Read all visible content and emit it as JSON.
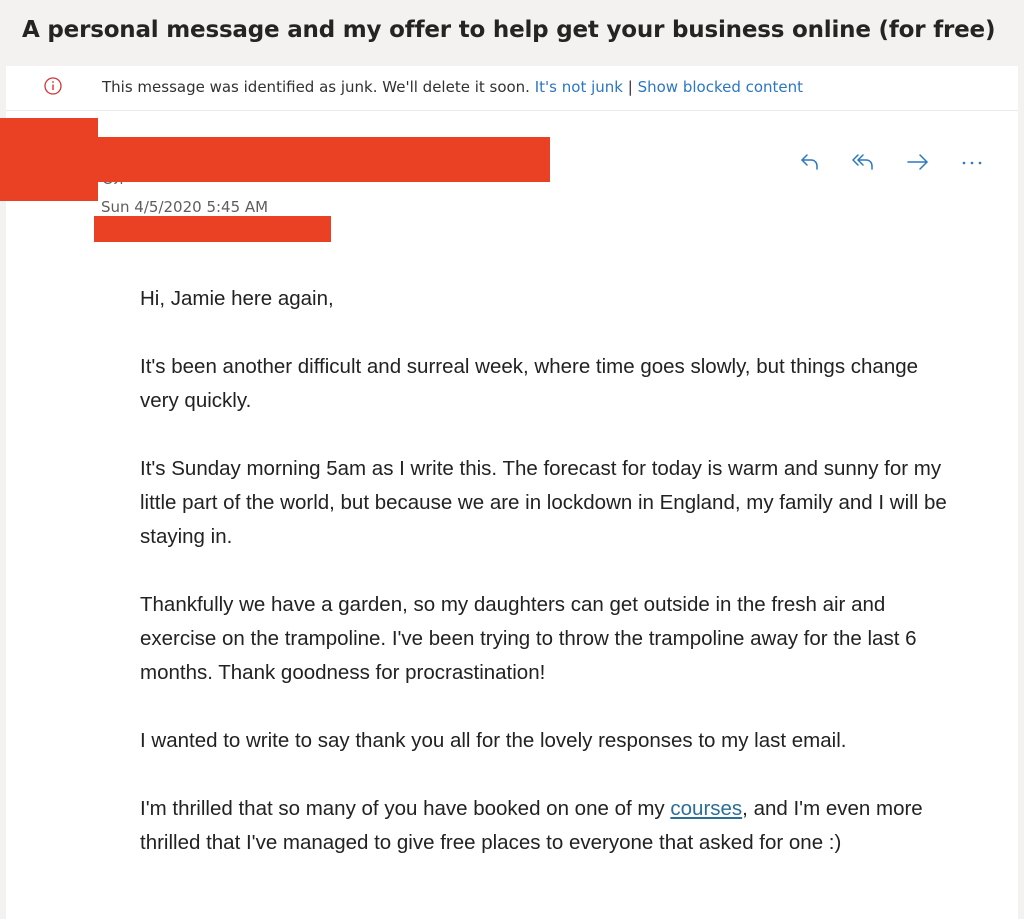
{
  "subject": "A personal message and my offer to help get your business online (for free)",
  "junk_notice": {
    "icon": "info-circle-icon",
    "icon_color": "#d13438",
    "text": "This message was identified as junk. We'll delete it soon.",
    "not_junk_link": "It's not junk",
    "separator": "|",
    "show_blocked_link": "Show blocked content"
  },
  "header": {
    "sender_partial": "Ол",
    "date": "Sun 4/5/2020 5:45 AM",
    "actions": {
      "reply": "reply-icon",
      "reply_all": "reply-all-icon",
      "forward": "forward-icon",
      "more": "more-icon",
      "more_label": "···"
    },
    "accent_color": "#2b77c2"
  },
  "redaction_color": "#ea4024",
  "body": {
    "greeting": "Hi, Jamie here again,",
    "p1": "It's been another difficult and surreal week, where time goes slowly, but things change very quickly.",
    "p2": "It's Sunday morning 5am as I write this.  The forecast for today is warm and sunny for my little part of the world, but because we are in lockdown in England, my family and I will be staying in.",
    "p3": "Thankfully we have a garden, so my daughters can get outside in the fresh air and exercise on the trampoline. I've been trying to throw the trampoline away for the last 6 months. Thank goodness for procrastination!",
    "p4": "I wanted to write to say thank you all for the lovely responses to my last email.",
    "p5_before": "I'm thrilled that so many of you have booked on one of my ",
    "p5_link": "courses",
    "p5_after": ", and I'm even more thrilled that I've managed to give free places to everyone that asked for one :)"
  }
}
